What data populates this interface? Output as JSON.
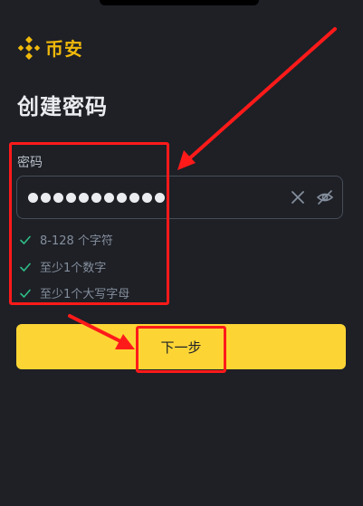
{
  "brand": {
    "name": "币安",
    "logo_icon": "binance-logo-icon",
    "color": "#f0b90b"
  },
  "page": {
    "title": "创建密码"
  },
  "password": {
    "label": "密码",
    "masked_length": 11,
    "clear_icon": "close-icon",
    "visibility_icon": "eye-off-icon"
  },
  "requirements": [
    {
      "text": "8-128 个字符",
      "icon": "check-icon"
    },
    {
      "text": "至少1个数字",
      "icon": "check-icon"
    },
    {
      "text": "至少1个大写字母",
      "icon": "check-icon"
    }
  ],
  "actions": {
    "next_label": "下一步"
  },
  "colors": {
    "background": "#1e2026",
    "accent": "#fcd535",
    "check": "#2ebd85",
    "annotation": "#ff1a1a"
  }
}
